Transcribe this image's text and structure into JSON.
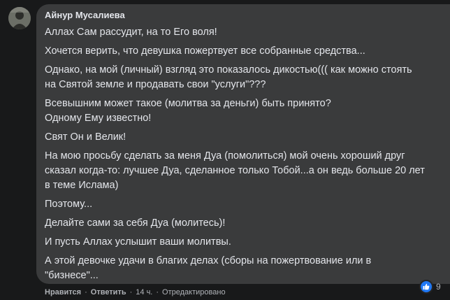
{
  "comment": {
    "author": "Айнур Мусалиева",
    "paragraphs": [
      "Аллах Сам рассудит, на то Его воля!",
      "Хочется верить, что девушка пожертвует все собранные средства...",
      "Однако, на мой (личный) взгляд это показалось дикостью((( как можно стоять\nна Святой земле и продавать свои \"услуги\"???",
      "Всевышним может такое (молитва за деньги) быть принято?\nОдному Ему известно!",
      "Свят Он и Велик!",
      "На мою просьбу сделать за меня Дуа (помолиться) мой очень хороший друг\nсказал когда-то: лучшее Дуа, сделанное только Тобой...а он ведь больше 20 лет\nв теме Ислама)",
      "Поэтому...",
      "Делайте сами за себя Дуа (молитесь)!",
      "И пусть Аллах услышит ваши молитвы.",
      "А этой девочке удачи в благих делах (сборы на пожертвование или в\n\"бизнесе\"..."
    ],
    "reaction_count": "9"
  },
  "actions": {
    "like_label": "Нравится",
    "reply_label": "Ответить",
    "time_label": "14 ч.",
    "edited_label": "Отредактировано"
  },
  "colors": {
    "bubble": "#3a3b3c",
    "text": "#e4e6eb",
    "secondary": "#b0b3b8",
    "like_blue": "#2078f4"
  },
  "icons": {
    "avatar": "user-photo",
    "reaction": "thumbs-up-icon"
  }
}
